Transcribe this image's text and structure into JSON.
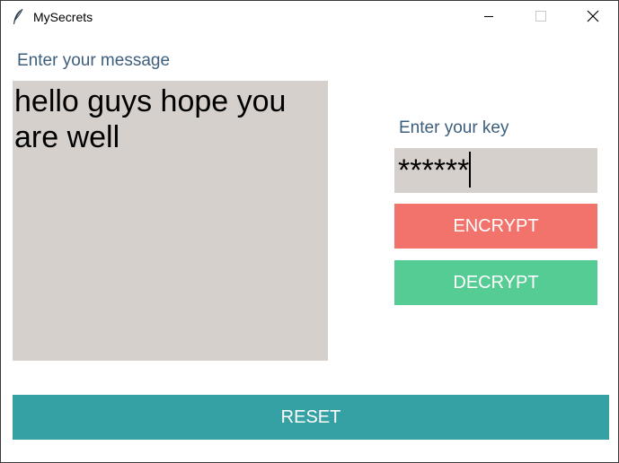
{
  "window": {
    "title": "MySecrets",
    "app_icon": "feather-icon",
    "controls": {
      "minimize_icon": "minimize-icon",
      "maximize_icon": "maximize-icon",
      "close_icon": "close-icon"
    }
  },
  "message": {
    "label": "Enter your message",
    "text": "hello guys hope you are well"
  },
  "key": {
    "label": "Enter your key",
    "value": "******"
  },
  "buttons": {
    "encrypt_label": "ENCRYPT",
    "decrypt_label": "DECRYPT",
    "reset_label": "RESET"
  },
  "colors": {
    "label_text": "#3d5f7d",
    "input_background": "#d6d0cd",
    "encrypt": "#f2736b",
    "decrypt": "#56cc95",
    "reset": "#36a1a4",
    "button_text": "#ffffff"
  }
}
